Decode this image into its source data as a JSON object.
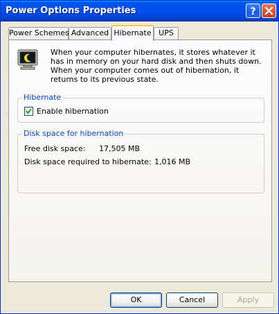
{
  "window": {
    "title": "Power Options Properties",
    "help_button": "?",
    "close_button": "X"
  },
  "tabs": [
    {
      "label": "Power Schemes",
      "active": false
    },
    {
      "label": "Advanced",
      "active": false
    },
    {
      "label": "Hibernate",
      "active": true
    },
    {
      "label": "UPS",
      "active": false
    }
  ],
  "hibernate": {
    "icon": "hibernate-monitor-icon",
    "description": "When your computer hibernates, it stores whatever it has in memory on your hard disk and then shuts down. When your computer comes out of hibernation, it returns to its previous state.",
    "group_title": "Hibernate",
    "checkbox_label": "Enable hibernation",
    "checkbox_checked": true
  },
  "disk_space": {
    "group_title": "Disk space for hibernation",
    "free_label": "Free disk space:",
    "free_value": "17,505 MB",
    "required_label": "Disk space required to hibernate:",
    "required_value": "1,016 MB"
  },
  "buttons": {
    "ok": "OK",
    "cancel": "Cancel",
    "apply": "Apply"
  },
  "colors": {
    "titlebar": "#0053ee",
    "group_title": "#0046d5",
    "active_tab_accent": "#ffc83c",
    "checkbox_check": "#21a121"
  }
}
